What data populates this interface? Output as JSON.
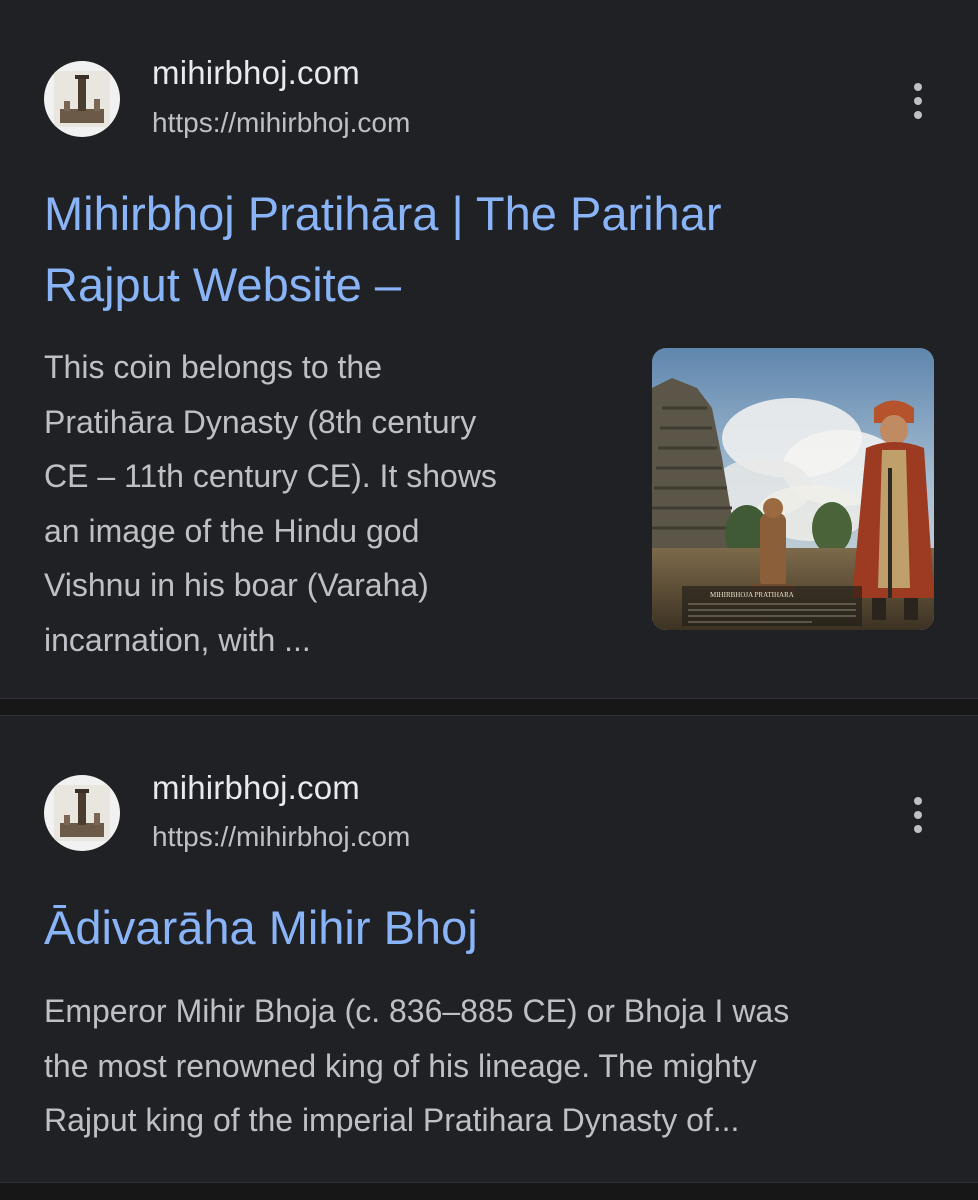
{
  "results": [
    {
      "site_name": "mihirbhoj.com",
      "url": "https://mihirbhoj.com",
      "title_line1": "Mihirbhoj Pratihāra | The Parihar",
      "title_line2": "Rajput Website –",
      "snippet_lines": [
        "This coin belongs to the",
        "Pratihāra Dynasty (8th century",
        "CE – 11th century CE). It shows",
        "an image of the Hindu god",
        "Vishnu in his boar (Varaha)",
        "incarnation, with ..."
      ],
      "thumbnail": "painting of temple and Rajput king in turban",
      "thumbnail_caption": "MIHIRBHOJA PRATIHARA"
    },
    {
      "site_name": "mihirbhoj.com",
      "url": "https://mihirbhoj.com",
      "title_line1": "Ādivarāha Mihir Bhoj",
      "snippet_lines": [
        "Emperor Mihir Bhoja (c. 836–885 CE) or Bhoja I was",
        "the most renowned king of his lineage. The mighty",
        "Rajput king of the imperial Pratihara Dynasty of..."
      ]
    }
  ],
  "icons": {
    "favicon": "pillar-favicon-icon",
    "more": "more-vert-icon"
  },
  "colors": {
    "background": "#202124",
    "title_link": "#8ab4f8",
    "site_name": "#e8eaed",
    "snippet": "#bdc1c6"
  }
}
